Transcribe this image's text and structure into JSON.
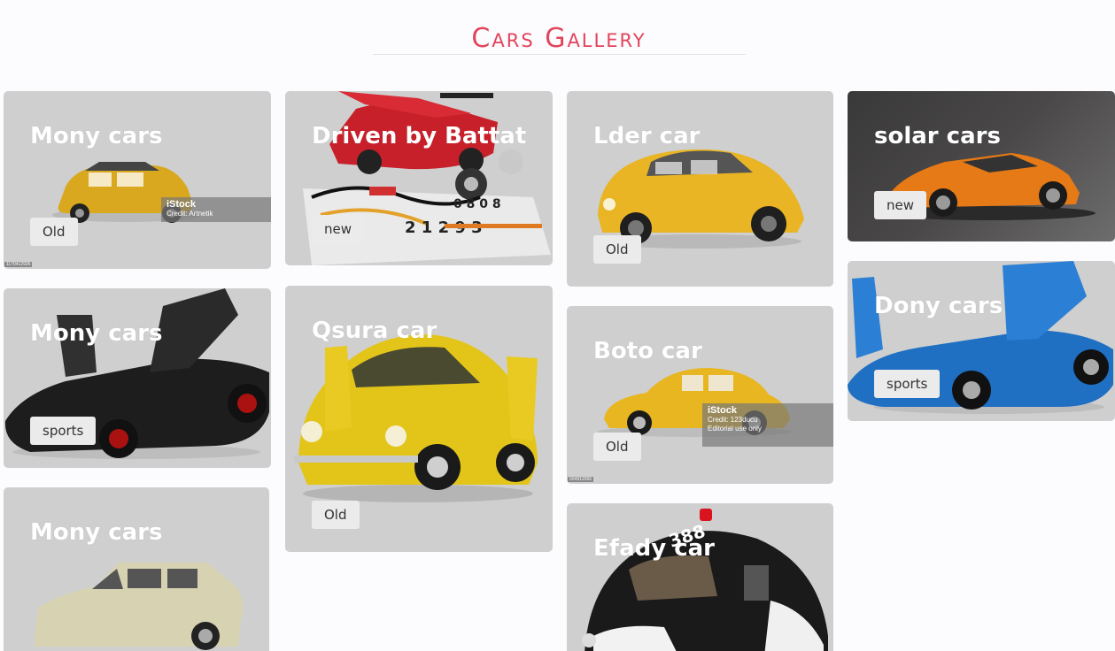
{
  "header": {
    "title": "Cars Gallery"
  },
  "cards": [
    {
      "title": "Mony cars",
      "badge": "Old",
      "watermark": {
        "brand": "iStock",
        "credit": "Credit: Artnetik"
      },
      "stock_id": "1170412926"
    },
    {
      "title": "Driven by Battat",
      "badge": "new"
    },
    {
      "title": "Lder car",
      "badge": "Old"
    },
    {
      "title": "solar cars",
      "badge": "new"
    },
    {
      "title": "Mony cars",
      "badge": "sports"
    },
    {
      "title": "Qsura car",
      "badge": "Old"
    },
    {
      "title": "Boto car",
      "badge": "Old",
      "watermark": {
        "brand": "iStock",
        "credit": "Credit: 123ducu",
        "note": "Editorial use only"
      },
      "stock_id": "504912066"
    },
    {
      "title": "Dony cars",
      "badge": "sports"
    },
    {
      "title": "Mony cars",
      "badge": ""
    },
    {
      "title": "Efady car",
      "badge": "",
      "plate": "388"
    }
  ],
  "colors": {
    "title": "#e2445c",
    "card_bg": "#cfcfcf",
    "badge_bg": "#ebebeb"
  },
  "icons": [
    "yellow-fiat-car-image",
    "red-kit-car-image",
    "yellow-beetle-image",
    "orange-lamborghini-image",
    "black-supercar-image",
    "yellow-beetle-open-doors-image",
    "yellow-beetle-side-image",
    "blue-supercar-image",
    "beige-sedan-image",
    "police-beetle-image"
  ]
}
